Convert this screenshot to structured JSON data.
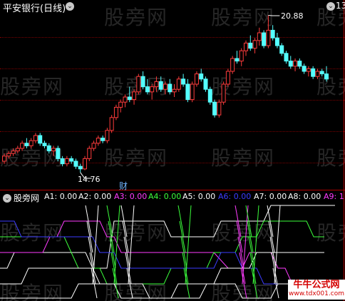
{
  "main_panel": {
    "title": "平安银行(日线)",
    "max_price_label": "20.88",
    "min_price_label": "14.76",
    "event_marker": "财",
    "corner_value": "13"
  },
  "indicator_panel": {
    "title": "股旁网",
    "series": [
      {
        "label": "A1:",
        "value": "0.00",
        "color": "#ffffff"
      },
      {
        "label": "A2:",
        "value": "0.00",
        "color": "#ffffff"
      },
      {
        "label": "A3:",
        "value": "0.00",
        "color": "#ff3cff"
      },
      {
        "label": "A4:",
        "value": "0.00",
        "color": "#3cff3c"
      },
      {
        "label": "A5:",
        "value": "0.00",
        "color": "#ffffff"
      },
      {
        "label": "A6:",
        "value": "0.00",
        "color": "#3c3cff"
      },
      {
        "label": "A7:",
        "value": "0.00",
        "color": "#ffffff"
      },
      {
        "label": "A8:",
        "value": "0.00",
        "color": "#ffffff"
      },
      {
        "label": "A9:",
        "value": "1",
        "color": "#ff3cff"
      }
    ]
  },
  "watermark": {
    "text": "股旁网"
  },
  "site_badge": {
    "title": "牛牛公式网",
    "url": "www.tdx001.com"
  },
  "colors": {
    "up": "#ff3c3c",
    "down": "#54ffff",
    "grid": "#7a0000",
    "frame": "#b00000"
  },
  "chart_data": {
    "type": "candlestick",
    "title": "平安银行(日线)",
    "annotations": [
      {
        "text": "20.88",
        "kind": "high"
      },
      {
        "text": "14.76",
        "kind": "low"
      }
    ],
    "candles": [
      [
        15.2,
        15.5,
        15.1,
        15.4
      ],
      [
        15.4,
        15.6,
        15.3,
        15.5
      ],
      [
        15.5,
        15.7,
        15.4,
        15.6
      ],
      [
        15.6,
        15.8,
        15.5,
        15.7
      ],
      [
        15.7,
        16.0,
        15.6,
        15.9
      ],
      [
        15.9,
        16.1,
        15.7,
        15.8
      ],
      [
        15.8,
        16.1,
        15.7,
        16.0
      ],
      [
        16.0,
        16.3,
        15.9,
        16.2
      ],
      [
        16.2,
        16.3,
        15.8,
        15.9
      ],
      [
        15.9,
        16.0,
        15.7,
        15.8
      ],
      [
        15.8,
        15.9,
        15.5,
        15.6
      ],
      [
        15.6,
        15.8,
        15.4,
        15.7
      ],
      [
        15.7,
        15.8,
        15.2,
        15.3
      ],
      [
        15.3,
        15.4,
        15.0,
        15.1
      ],
      [
        15.1,
        15.4,
        15.0,
        15.3
      ],
      [
        15.3,
        15.4,
        15.1,
        15.2
      ],
      [
        15.2,
        15.3,
        14.9,
        15.0
      ],
      [
        15.0,
        15.1,
        14.76,
        14.9
      ],
      [
        14.9,
        15.4,
        14.85,
        15.3
      ],
      [
        15.3,
        15.8,
        15.2,
        15.7
      ],
      [
        15.7,
        16.0,
        15.6,
        15.9
      ],
      [
        15.9,
        16.2,
        15.8,
        16.1
      ],
      [
        16.1,
        16.2,
        15.9,
        16.0
      ],
      [
        16.0,
        16.5,
        15.9,
        16.4
      ],
      [
        16.4,
        17.0,
        16.3,
        16.9
      ],
      [
        16.9,
        17.4,
        16.8,
        17.3
      ],
      [
        17.3,
        17.6,
        17.1,
        17.5
      ],
      [
        17.5,
        17.8,
        17.3,
        17.7
      ],
      [
        17.7,
        18.1,
        17.5,
        17.6
      ],
      [
        17.6,
        18.0,
        17.4,
        17.9
      ],
      [
        17.9,
        18.6,
        17.8,
        18.5
      ],
      [
        18.5,
        18.7,
        18.0,
        18.1
      ],
      [
        18.1,
        18.4,
        17.8,
        17.9
      ],
      [
        17.9,
        18.2,
        17.6,
        18.1
      ],
      [
        18.1,
        18.5,
        17.9,
        18.3
      ],
      [
        18.3,
        18.5,
        17.9,
        18.0
      ],
      [
        18.0,
        18.3,
        17.8,
        18.2
      ],
      [
        18.2,
        18.4,
        17.8,
        17.9
      ],
      [
        17.9,
        18.2,
        17.7,
        18.0
      ],
      [
        18.0,
        18.5,
        17.9,
        18.4
      ],
      [
        18.4,
        18.6,
        18.1,
        18.2
      ],
      [
        18.2,
        18.4,
        17.5,
        17.6
      ],
      [
        17.6,
        18.3,
        17.5,
        18.2
      ],
      [
        18.2,
        18.7,
        18.1,
        18.6
      ],
      [
        18.6,
        18.8,
        18.3,
        18.4
      ],
      [
        18.4,
        18.5,
        17.9,
        18.0
      ],
      [
        18.0,
        18.1,
        17.4,
        17.5
      ],
      [
        17.5,
        17.6,
        16.9,
        17.0
      ],
      [
        17.0,
        17.6,
        16.9,
        17.5
      ],
      [
        17.5,
        18.3,
        17.4,
        18.2
      ],
      [
        18.2,
        18.8,
        18.1,
        18.7
      ],
      [
        18.7,
        19.3,
        18.6,
        19.2
      ],
      [
        19.2,
        19.5,
        19.0,
        19.1
      ],
      [
        19.1,
        19.6,
        18.9,
        19.5
      ],
      [
        19.5,
        19.9,
        19.3,
        19.8
      ],
      [
        19.8,
        20.1,
        19.5,
        19.6
      ],
      [
        19.6,
        20.0,
        19.4,
        19.9
      ],
      [
        19.9,
        20.4,
        19.7,
        20.2
      ],
      [
        20.2,
        20.3,
        19.6,
        19.7
      ],
      [
        19.7,
        20.88,
        19.6,
        20.3
      ],
      [
        20.3,
        20.5,
        19.9,
        20.0
      ],
      [
        20.0,
        20.2,
        19.6,
        19.7
      ],
      [
        19.7,
        19.8,
        19.3,
        19.4
      ],
      [
        19.4,
        19.5,
        19.0,
        19.1
      ],
      [
        19.1,
        19.3,
        18.8,
        18.9
      ],
      [
        18.9,
        19.2,
        18.7,
        19.1
      ],
      [
        19.1,
        19.2,
        18.8,
        18.9
      ],
      [
        18.9,
        19.0,
        18.6,
        18.7
      ],
      [
        18.7,
        18.9,
        18.5,
        18.8
      ],
      [
        18.8,
        18.9,
        18.4,
        18.5
      ],
      [
        18.5,
        18.8,
        18.4,
        18.7
      ],
      [
        18.7,
        18.8,
        18.5,
        18.6
      ],
      [
        18.6,
        18.9,
        18.3,
        18.4
      ]
    ],
    "ylim": [
      14.2,
      21.2
    ],
    "grid": true
  }
}
